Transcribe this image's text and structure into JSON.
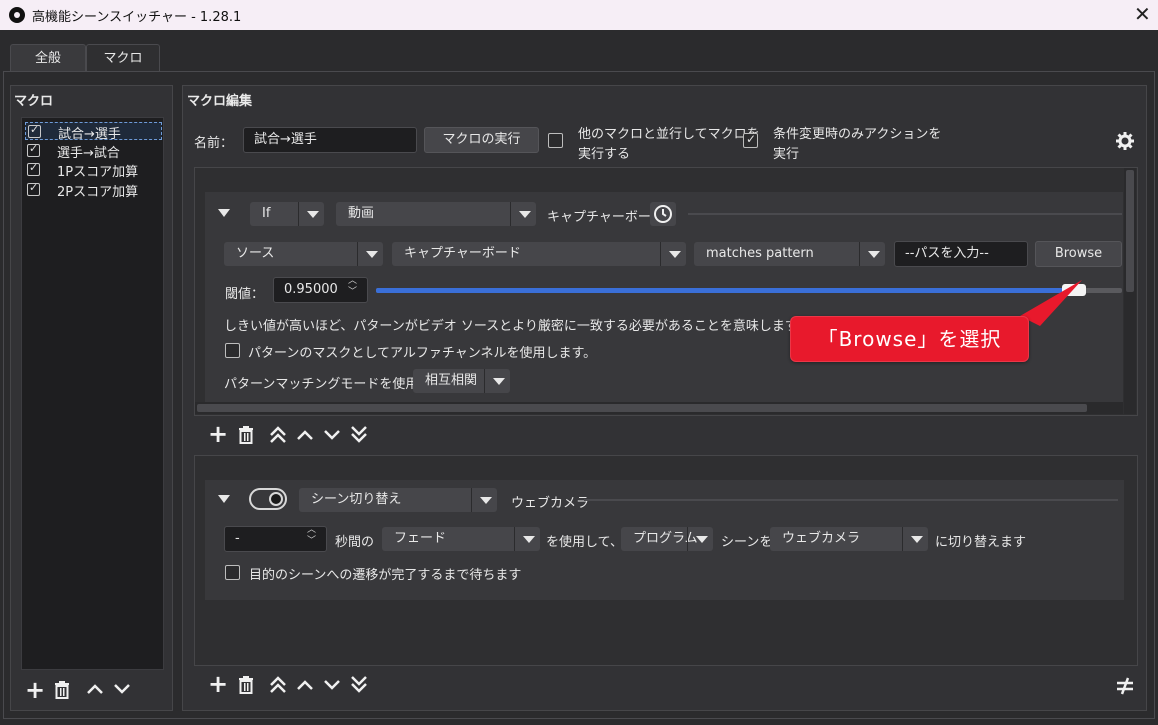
{
  "window": {
    "title": "高機能シーンスイッチャー - 1.28.1"
  },
  "tabs": [
    {
      "label": "全般"
    },
    {
      "label": "マクロ"
    }
  ],
  "macros_panel": {
    "title": "マクロ",
    "items": [
      {
        "label": "試合→選手",
        "checked": true,
        "selected": true
      },
      {
        "label": "選手→試合",
        "checked": true
      },
      {
        "label": "1Pスコア加算",
        "checked": true
      },
      {
        "label": "2Pスコア加算",
        "checked": true
      }
    ]
  },
  "editor": {
    "title": "マクロ編集",
    "name_label": "名前：",
    "name_value": "試合→選手",
    "run_button": "マクロの実行",
    "parallel_label_1": "他のマクロと並行してマクロを",
    "parallel_label_2": "実行する",
    "parallel_checked": false,
    "onchange_label_1": "条件変更時のみアクションを",
    "onchange_label_2": "実行",
    "onchange_checked": true
  },
  "condition": {
    "logic": "If",
    "type": "動画",
    "header_source": "キャプチャーボード",
    "source_kind": "ソース",
    "source_name": "キャプチャーボード",
    "match_mode": "matches pattern",
    "path_placeholder": "--パスを入力--",
    "browse_button": "Browse",
    "threshold_label": "閾値：",
    "threshold_value": "0.95000",
    "threshold_fraction": 0.95,
    "threshold_help": "しきい値が高いほど、パターンがビデオ ソースとより厳密に一致する必要があることを意味します。",
    "alpha_mask_label": "パターンのマスクとしてアルファチャンネルを使用します。",
    "alpha_mask_checked": false,
    "pattern_mode_label": "パターンマッチングモードを使用する",
    "pattern_mode_value": "相互相関"
  },
  "action": {
    "type": "シーン切り替え",
    "header_scene": "ウェブカメラ",
    "duration_value": "-",
    "seconds_label": "秒間の",
    "transition": "フェード",
    "using_label": "を使用して、",
    "target": "プログラム",
    "scene_label": "シーンを",
    "scene": "ウェブカメラ",
    "switch_label": "に切り替えます",
    "wait_label": "目的のシーンへの遷移が完了するまで待ちます",
    "wait_checked": false
  },
  "callout": {
    "text": "「Browse」を選択"
  },
  "colors": {
    "accent": "#3a6fd8",
    "callout": "#e8192c",
    "titlebar": "#f6eef6",
    "background": "#2b2b2d"
  },
  "icons": [
    "obs-logo-icon",
    "close-icon",
    "plus-icon",
    "trash-icon",
    "double-up-icon",
    "up-icon",
    "down-icon",
    "double-down-icon",
    "gear-icon",
    "clock-icon",
    "not-equal-icon"
  ]
}
